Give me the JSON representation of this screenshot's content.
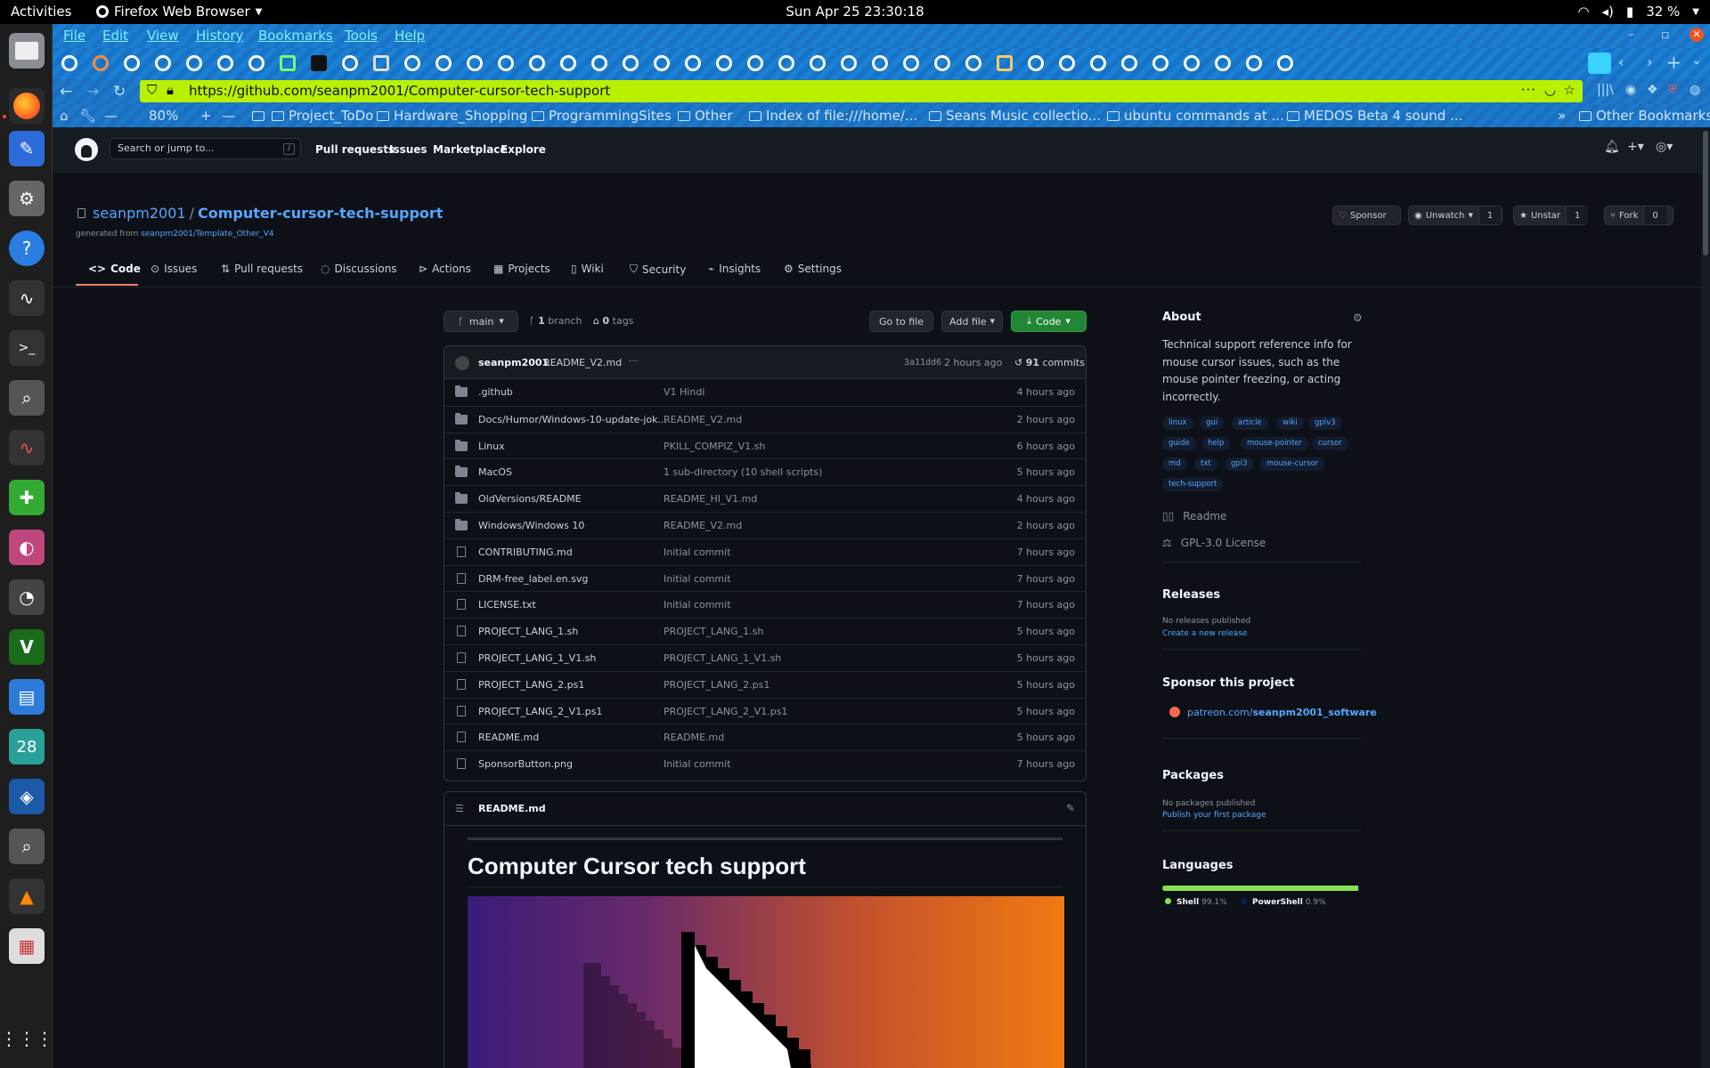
{
  "topbar": {
    "activities": "Activities",
    "app_name": "Firefox Web Browser",
    "clock": "Sun Apr 25  23:30:18",
    "battery": "32 %"
  },
  "menubar": {
    "items": [
      "File",
      "Edit",
      "View",
      "History",
      "Bookmarks",
      "Tools",
      "Help"
    ]
  },
  "nav": {
    "url": "https://github.com/seanpm2001/Computer-cursor-tech-support",
    "zoom": "80%"
  },
  "bookmarks": {
    "items": [
      "Project_ToDo",
      "Hardware_Shopping",
      "ProgrammingSites",
      "Other",
      "Index of file:///home/...",
      "Seans Music collectio...",
      "ubuntu commands at ...",
      "MEDOS Beta 4 sound ..."
    ],
    "other": "Other Bookmarks"
  },
  "github": {
    "search_placeholder": "Search or jump to...",
    "search_key": "/",
    "nav": [
      "Pull requests",
      "Issues",
      "Marketplace",
      "Explore"
    ]
  },
  "repo": {
    "owner": "seanpm2001",
    "separator": "/",
    "name": "Computer-cursor-tech-support",
    "generated_prefix": "generated from",
    "generated_from": "seanpm2001/Template_Other_V4",
    "sponsor": "Sponsor",
    "unwatch": "Unwatch",
    "unwatch_count": "1",
    "unstar": "Unstar",
    "star_count": "1",
    "fork": "Fork",
    "fork_count": "0",
    "tabs": [
      "Code",
      "Issues",
      "Pull requests",
      "Discussions",
      "Actions",
      "Projects",
      "Wiki",
      "Security",
      "Insights",
      "Settings"
    ]
  },
  "branchbar": {
    "branch": "main",
    "branches_count": "1",
    "branches_label": "branch",
    "tags_count": "0",
    "tags_label": "tags",
    "go_to_file": "Go to file",
    "add_file": "Add file",
    "code": "Code"
  },
  "commit": {
    "author": "seanpm2001",
    "message": "README_V2.md",
    "dots": "···",
    "sha": "3a11dd6",
    "time": "2 hours ago",
    "count": "91",
    "count_label": "commits"
  },
  "files": [
    {
      "name": ".github",
      "type": "dir",
      "commit": "V1 Hindi",
      "time": "4 hours ago"
    },
    {
      "name": "Docs/Humor/Windows-10-update-jok...",
      "type": "dir",
      "commit": "README_V2.md",
      "time": "2 hours ago"
    },
    {
      "name": "Linux",
      "type": "dir",
      "commit": "PKILL_COMPIZ_V1.sh",
      "time": "6 hours ago"
    },
    {
      "name": "MacOS",
      "type": "dir",
      "commit": "1 sub-directory (10 shell scripts)",
      "time": "5 hours ago"
    },
    {
      "name": "OldVersions/README",
      "type": "dir",
      "commit": "README_HI_V1.md",
      "time": "4 hours ago"
    },
    {
      "name": "Windows/Windows 10",
      "type": "dir",
      "commit": "README_V2.md",
      "time": "2 hours ago"
    },
    {
      "name": "CONTRIBUTING.md",
      "type": "file",
      "commit": "Initial commit",
      "time": "7 hours ago"
    },
    {
      "name": "DRM-free_label.en.svg",
      "type": "file",
      "commit": "Initial commit",
      "time": "7 hours ago"
    },
    {
      "name": "LICENSE.txt",
      "type": "file",
      "commit": "Initial commit",
      "time": "7 hours ago"
    },
    {
      "name": "PROJECT_LANG_1.sh",
      "type": "file",
      "commit": "PROJECT_LANG_1.sh",
      "time": "5 hours ago"
    },
    {
      "name": "PROJECT_LANG_1_V1.sh",
      "type": "file",
      "commit": "PROJECT_LANG_1_V1.sh",
      "time": "5 hours ago"
    },
    {
      "name": "PROJECT_LANG_2.ps1",
      "type": "file",
      "commit": "PROJECT_LANG_2.ps1",
      "time": "5 hours ago"
    },
    {
      "name": "PROJECT_LANG_2_V1.ps1",
      "type": "file",
      "commit": "PROJECT_LANG_2_V1.ps1",
      "time": "5 hours ago"
    },
    {
      "name": "README.md",
      "type": "file",
      "commit": "README.md",
      "time": "5 hours ago"
    },
    {
      "name": "SponsorButton.png",
      "type": "file",
      "commit": "Initial commit",
      "time": "7 hours ago"
    }
  ],
  "readme": {
    "filename": "README.md",
    "heading": "Computer Cursor tech support"
  },
  "about": {
    "title": "About",
    "description": "Technical support reference info for mouse cursor issues, such as the mouse pointer freezing, or acting incorrectly.",
    "topics": [
      "linux",
      "gui",
      "article",
      "wiki",
      "gplv3",
      "guide",
      "help",
      "mouse-pointer",
      "cursor",
      "md",
      "txt",
      "gpl3",
      "mouse-cursor",
      "tech-support"
    ],
    "readme": "Readme",
    "license": "GPL-3.0 License"
  },
  "releases": {
    "title": "Releases",
    "none": "No releases published",
    "create": "Create a new release"
  },
  "sponsor_project": {
    "title": "Sponsor this project",
    "link_prefix": "patreon.com/",
    "link_bold": "seanpm2001_software"
  },
  "packages": {
    "title": "Packages",
    "none": "No packages published",
    "publish": "Publish your first package"
  },
  "languages": {
    "title": "Languages",
    "items": [
      {
        "name": "Shell",
        "percent": "99.1%",
        "share": 99.1,
        "color": "#89e051"
      },
      {
        "name": "PowerShell",
        "percent": "0.9%",
        "share": 0.9,
        "color": "#012456"
      }
    ]
  },
  "colors": {
    "accent_link": "#58a6ff",
    "code_button": "#238636",
    "url_bar": "#b8f000",
    "tab_underline": "#f78166"
  }
}
